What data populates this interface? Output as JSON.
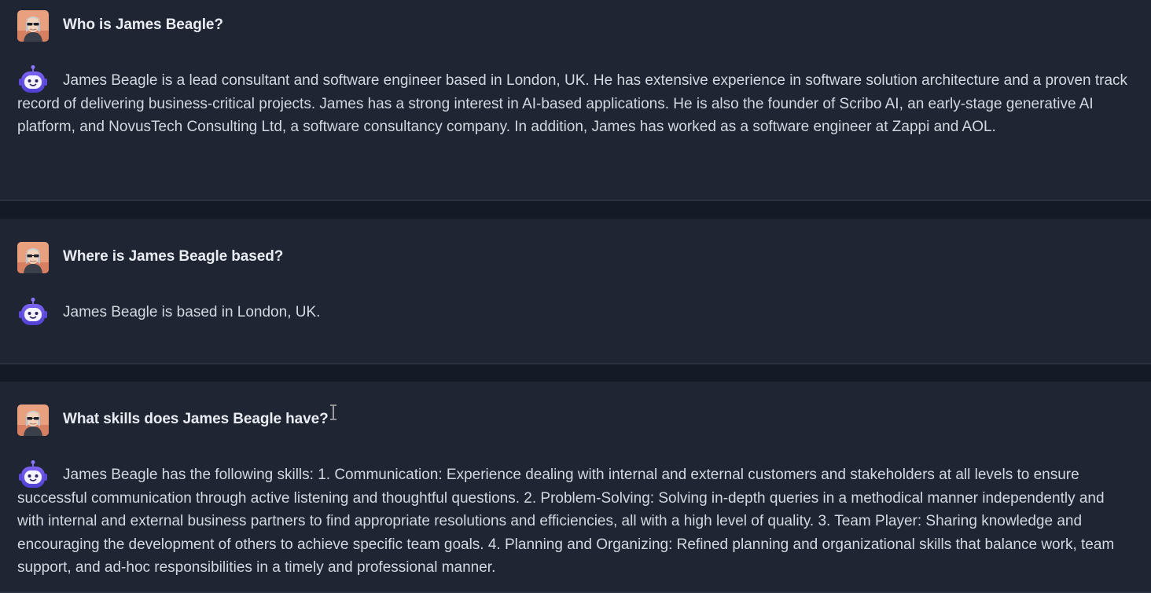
{
  "conversation": [
    {
      "question": "Who is James Beagle?",
      "answer": "James Beagle is a lead consultant and software engineer based in London, UK. He has extensive experience in software solution architecture and a proven track record of delivering business-critical projects. James has a strong interest in AI-based applications. He is also the founder of Scribo AI, an early-stage generative AI platform, and NovusTech Consulting Ltd, a software consultancy company. In addition, James has worked as a software engineer at Zappi and AOL."
    },
    {
      "question": "Where is James Beagle based?",
      "answer": "James Beagle is based in London, UK."
    },
    {
      "question": "What skills does James Beagle have?",
      "answer": "James Beagle has the following skills: 1. Communication: Experience dealing with internal and external customers and stakeholders at all levels to ensure successful communication through active listening and thoughtful questions. 2. Problem-Solving: Solving in-depth queries in a methodical manner independently and with internal and external business partners to find appropriate resolutions and efficiencies, all with a high level of quality. 3. Team Player: Sharing knowledge and encouraging the development of others to achieve specific team goals. 4. Planning and Organizing: Refined planning and organizational skills that balance work, team support, and ad-hoc responsibilities in a timely and professional manner."
    }
  ],
  "icons": {
    "user_avatar": "user-avatar-photo",
    "bot_avatar": "robot-icon",
    "cursor": "text-cursor-icon"
  },
  "colors": {
    "page_background": "#141b26",
    "message_background": "#1f2533",
    "question_text": "#e9ecf2",
    "answer_text": "#d3d8e1",
    "bot_accent": "#6b54e8"
  }
}
